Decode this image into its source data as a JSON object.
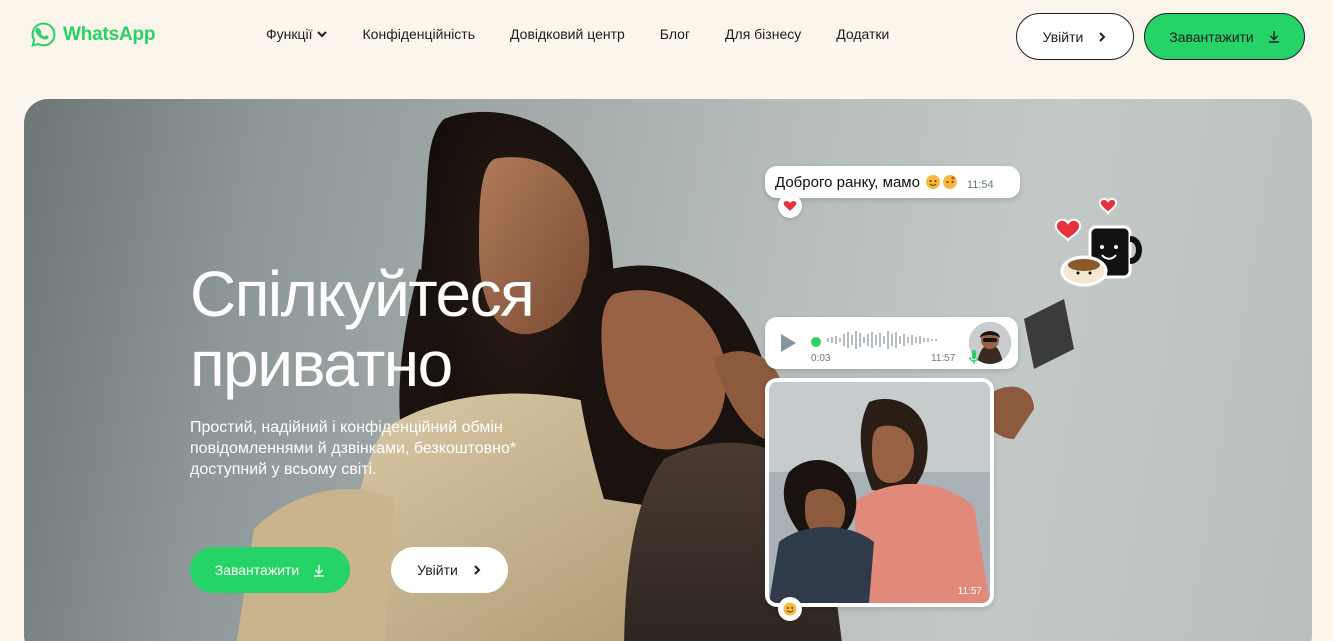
{
  "header": {
    "logo_text": "WhatsApp",
    "nav": [
      {
        "label": "Функції"
      },
      {
        "label": "Конфіденційність"
      },
      {
        "label": "Довідковий центр"
      },
      {
        "label": "Блог"
      },
      {
        "label": "Для бізнесу"
      },
      {
        "label": "Додатки"
      }
    ],
    "login_label": "Увійти",
    "download_label": "Завантажити"
  },
  "hero": {
    "title_line1": "Спілкуйтеся",
    "title_line2": "приватно",
    "subtitle": "Простий, надійний і конфіденційний обмін повідомленнями й дзвінками, безкоштовно* доступний у всьому світі.",
    "download_label": "Завантажити",
    "login_label": "Увійти"
  },
  "chat": {
    "message_text": "Доброго ранку, мамо",
    "message_time": "11:54",
    "voice_elapsed": "0:03",
    "voice_time": "11:57",
    "photo_time": "11:57"
  },
  "colors": {
    "brand_green": "#25d366",
    "page_bg": "#fcf5eb",
    "text_dark": "#1c1e21"
  },
  "icons": [
    "whatsapp-logo-icon",
    "chevron-down-icon",
    "chevron-right-icon",
    "download-icon",
    "play-icon",
    "microphone-icon",
    "heart-icon"
  ]
}
